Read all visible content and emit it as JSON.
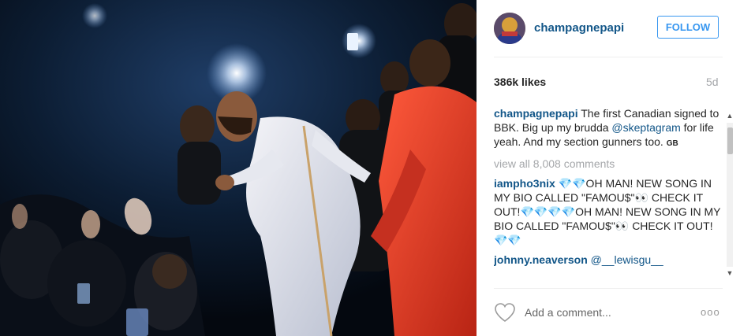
{
  "post": {
    "username": "champagnepapi",
    "follow_label": "FOLLOW",
    "likes": "386k likes",
    "age": "5d",
    "caption": {
      "username": "champagnepapi",
      "text_1": "The first Canadian signed to BBK. Big up my brudda",
      "mention": "@skeptagram",
      "text_2": "for life yeah. And my section gunners too.",
      "flag": "GB"
    },
    "view_all_comments": "view all 8,008 comments",
    "comments": [
      {
        "username": "iampho3nix",
        "text": "💎💎OH MAN! NEW SONG IN MY BIO CALLED \"FAMOU$\"👀 CHECK IT OUT!💎💎💎💎OH MAN! NEW SONG IN MY BIO CALLED \"FAMOU$\"👀 CHECK IT OUT!💎💎"
      },
      {
        "username": "johnny.neaverson",
        "text": "@__lewisgu__"
      }
    ],
    "add_comment_placeholder": "Add a comment...",
    "more_options": "ooo"
  },
  "icons": {
    "heart": "heart-icon",
    "scroll_up": "scroll-up-arrow-icon",
    "scroll_down": "scroll-down-arrow-icon"
  },
  "colors": {
    "link": "#125688",
    "follow": "#3897f0",
    "muted": "#a5a7aa"
  }
}
